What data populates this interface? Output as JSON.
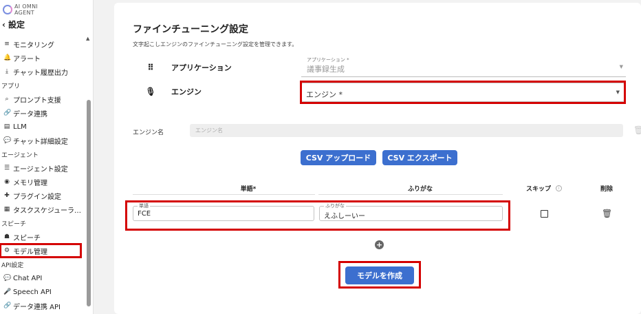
{
  "logo": {
    "line1": "AI OMNI",
    "line2": "AGENT"
  },
  "sidebar": {
    "back_label": "設定",
    "items": [
      {
        "type": "item",
        "icon": "≡",
        "icon_name": "stack-icon",
        "label": "モニタリング"
      },
      {
        "type": "item",
        "icon": "🔔",
        "icon_name": "bell-icon",
        "label": "アラート"
      },
      {
        "type": "item",
        "icon": "⤓",
        "icon_name": "download-icon",
        "label": "チャット履歴出力"
      },
      {
        "type": "section",
        "label": "アプリ"
      },
      {
        "type": "item",
        "icon": "⌕",
        "icon_name": "prompt-search-icon",
        "label": "プロンプト支援"
      },
      {
        "type": "item",
        "icon": "🔗",
        "icon_name": "link-icon",
        "label": "データ連携"
      },
      {
        "type": "item",
        "icon": "▤",
        "icon_name": "llm-icon",
        "label": "LLM"
      },
      {
        "type": "item",
        "icon": "💬",
        "icon_name": "chat-icon",
        "label": "チャット詳細設定"
      },
      {
        "type": "section",
        "label": "エージェント"
      },
      {
        "type": "item",
        "icon": "☰",
        "icon_name": "agent-icon",
        "label": "エージェント設定"
      },
      {
        "type": "item",
        "icon": "◉",
        "icon_name": "memory-icon",
        "label": "メモリ管理"
      },
      {
        "type": "item",
        "icon": "✚",
        "icon_name": "plugin-icon",
        "label": "プラグイン設定"
      },
      {
        "type": "item",
        "icon": "▦",
        "icon_name": "scheduler-icon",
        "label": "タスクスケジューラ…"
      },
      {
        "type": "section",
        "label": "スピーチ"
      },
      {
        "type": "item",
        "icon": "☗",
        "icon_name": "speech-icon",
        "label": "スピーチ"
      },
      {
        "type": "item",
        "icon": "⚙",
        "icon_name": "gear-icon",
        "label": "モデル管理",
        "active": true
      },
      {
        "type": "section",
        "label": "API設定"
      },
      {
        "type": "item",
        "icon": "💬",
        "icon_name": "chat-api-icon",
        "label": "Chat API"
      },
      {
        "type": "item",
        "icon": "🎤",
        "icon_name": "mic-icon",
        "label": "Speech API"
      },
      {
        "type": "item",
        "icon": "🔗",
        "icon_name": "link-icon",
        "label": "データ連携 API"
      }
    ]
  },
  "page": {
    "title": "ファインチューニング設定",
    "subtitle": "文字起こしエンジンのファインチューニング設定を管理できます。"
  },
  "application": {
    "row_label": "アプリケーション",
    "field_label": "アプリケーション *",
    "value": "議事録生成"
  },
  "engine": {
    "row_label": "エンジン",
    "value": "エンジン *"
  },
  "engine_name": {
    "label": "エンジン名",
    "placeholder": "エンジン名"
  },
  "buttons": {
    "csv_upload": "CSV アップロード",
    "csv_export": "CSV エクスポート",
    "create_model": "モデルを作成"
  },
  "table": {
    "headers": {
      "word": "単語*",
      "reading": "ふりがな",
      "skip": "スキップ",
      "delete": "削除"
    },
    "rows": [
      {
        "word_label": "単語",
        "word": "FCE",
        "reading_label": "ふりがな",
        "reading": "えふしーいー"
      }
    ]
  },
  "colors": {
    "accent": "#3c6fcf",
    "highlight": "#d40000"
  }
}
